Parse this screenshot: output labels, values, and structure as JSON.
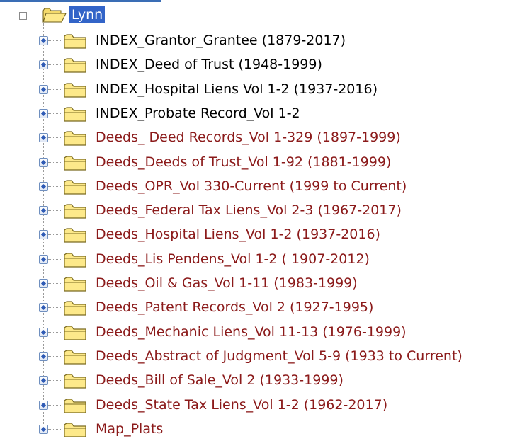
{
  "colors": {
    "selection_bg": "#3264c8",
    "selection_text": "#ffffff",
    "index_text": "#000000",
    "deeds_text": "#8b1a1a",
    "folder_fill": "#fde98a",
    "folder_stroke": "#7a6a20",
    "tree_lines": "#9a9a9a"
  },
  "tree": {
    "root": {
      "label": "Lynn",
      "icon": "folder-open-icon",
      "expanded": true,
      "selected": true
    },
    "items": [
      {
        "label": "INDEX_Grantor_Grantee (1879-2017)",
        "kind": "index",
        "icon": "folder-icon"
      },
      {
        "label": "INDEX_Deed of Trust (1948-1999)",
        "kind": "index",
        "icon": "folder-icon"
      },
      {
        "label": "INDEX_Hospital Liens Vol 1-2 (1937-2016)",
        "kind": "index",
        "icon": "folder-icon"
      },
      {
        "label": "INDEX_Probate Record_Vol 1-2",
        "kind": "index",
        "icon": "folder-icon"
      },
      {
        "label": "Deeds_ Deed Records_Vol 1-329 (1897-1999)",
        "kind": "deeds",
        "icon": "folder-icon"
      },
      {
        "label": "Deeds_Deeds of Trust_Vol 1-92 (1881-1999)",
        "kind": "deeds",
        "icon": "folder-icon"
      },
      {
        "label": "Deeds_OPR_Vol 330-Current (1999 to Current)",
        "kind": "deeds",
        "icon": "folder-icon"
      },
      {
        "label": "Deeds_Federal Tax Liens_Vol 2-3 (1967-2017)",
        "kind": "deeds",
        "icon": "folder-icon"
      },
      {
        "label": "Deeds_Hospital Liens_Vol 1-2 (1937-2016)",
        "kind": "deeds",
        "icon": "folder-icon"
      },
      {
        "label": "Deeds_Lis Pendens_Vol 1-2 ( 1907-2012)",
        "kind": "deeds",
        "icon": "folder-icon"
      },
      {
        "label": "Deeds_Oil & Gas_Vol 1-11 (1983-1999)",
        "kind": "deeds",
        "icon": "folder-icon"
      },
      {
        "label": "Deeds_Patent Records_Vol 2 (1927-1995)",
        "kind": "deeds",
        "icon": "folder-icon"
      },
      {
        "label": "Deeds_Mechanic Liens_Vol 11-13 (1976-1999)",
        "kind": "deeds",
        "icon": "folder-icon"
      },
      {
        "label": "Deeds_Abstract of Judgment_Vol 5-9 (1933 to Current)",
        "kind": "deeds",
        "icon": "folder-icon"
      },
      {
        "label": "Deeds_Bill of Sale_Vol 2 (1933-1999)",
        "kind": "deeds",
        "icon": "folder-icon"
      },
      {
        "label": "Deeds_State Tax Liens_Vol 1-2 (1962-2017)",
        "kind": "deeds",
        "icon": "folder-icon"
      },
      {
        "label": "Map_Plats",
        "kind": "deeds",
        "icon": "folder-icon"
      }
    ]
  }
}
